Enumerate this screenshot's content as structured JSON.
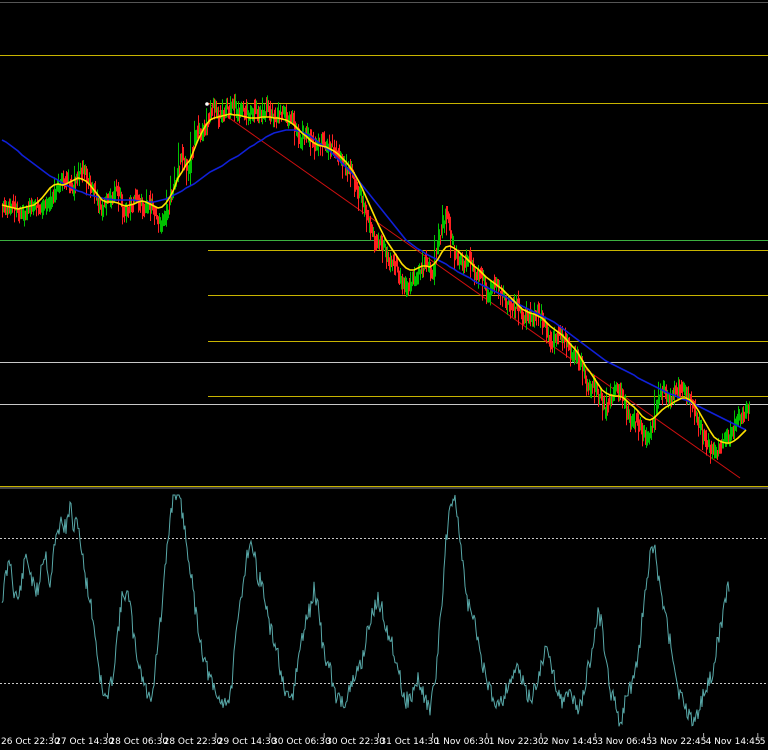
{
  "colors": {
    "background": "#000000",
    "bull_candle": "#00c000",
    "bear_candle": "#ff2020",
    "ma_fast": "#ffe000",
    "ma_slow": "#1020d8",
    "fib_level": "#c8b400",
    "horizontal_white": "#c8c8c8",
    "horizontal_green": "#3cb040",
    "trendline": "#d01010",
    "oscillator": "#58a8a8",
    "osc_level": "#c8c8c8",
    "text": "#ffffff"
  },
  "chart_data": [
    {
      "type": "candlestick",
      "panel": "price",
      "x": [
        0,
        4,
        8,
        12,
        16,
        20,
        24,
        28,
        32,
        36,
        40,
        44,
        48,
        52,
        56,
        60,
        64,
        68,
        72,
        76,
        80,
        84,
        88,
        92,
        96,
        100,
        104,
        108,
        112,
        116,
        120,
        124,
        128,
        132,
        136,
        140,
        144,
        148,
        152,
        156,
        160,
        164,
        168,
        172,
        176,
        180,
        184,
        188,
        192,
        196,
        200,
        204,
        208,
        212,
        216,
        220,
        224,
        228,
        232,
        236,
        240,
        244,
        248,
        252,
        256,
        260,
        264,
        268,
        272,
        276,
        280,
        284,
        288,
        292,
        296,
        300,
        304,
        308,
        312,
        316,
        320,
        324,
        328,
        332,
        336,
        340,
        344,
        348,
        352,
        356,
        360,
        364,
        368,
        372,
        376,
        380,
        384,
        388,
        392,
        396,
        400,
        404,
        408,
        412,
        416,
        420,
        424,
        428,
        432,
        436,
        440,
        444,
        448,
        452,
        456,
        460,
        464,
        468,
        472,
        476,
        480,
        484,
        488,
        492,
        496,
        500,
        504,
        508,
        512,
        516,
        520,
        524,
        528,
        532,
        536,
        540,
        544,
        548,
        552,
        556,
        560,
        564,
        568,
        572,
        576,
        580,
        584,
        588,
        592,
        596,
        600,
        604,
        608,
        612,
        616,
        620,
        624,
        628,
        632,
        636,
        640,
        644,
        648,
        652,
        656,
        660,
        664,
        668,
        672,
        676,
        680,
        684,
        688,
        692,
        696,
        700,
        704,
        708,
        712,
        716,
        720,
        724,
        728,
        732,
        736,
        740,
        744,
        748,
        752,
        756,
        760,
        764
      ],
      "close_series": [
        210,
        208,
        205,
        212,
        215,
        214,
        210,
        208,
        205,
        210,
        207,
        200,
        195,
        188,
        182,
        178,
        185,
        190,
        176,
        168,
        175,
        185,
        190,
        200,
        210,
        205,
        200,
        195,
        185,
        205,
        215,
        210,
        200,
        198,
        205,
        210,
        200,
        212,
        220,
        225,
        218,
        200,
        185,
        175,
        150,
        165,
        175,
        140,
        125,
        135,
        130,
        115,
        105,
        115,
        120,
        110,
        108,
        100,
        118,
        112,
        108,
        115,
        110,
        112,
        120,
        108,
        110,
        116,
        120,
        110,
        115,
        118,
        120,
        135,
        140,
        130,
        138,
        145,
        150,
        140,
        148,
        145,
        150,
        155,
        160,
        170,
        165,
        180,
        190,
        200,
        210,
        225,
        235,
        245,
        240,
        255,
        265,
        262,
        270,
        280,
        290,
        285,
        280,
        275,
        270,
        260,
        265,
        275,
        245,
        230,
        210,
        225,
        250,
        260,
        262,
        265,
        255,
        270,
        280,
        275,
        290,
        295,
        285,
        288,
        295,
        300,
        305,
        310,
        300,
        315,
        320,
        312,
        318,
        310,
        320,
        325,
        340,
        345,
        330,
        335,
        342,
        348,
        360,
        355,
        365,
        380,
        390,
        385,
        395,
        400,
        410,
        398,
        392,
        390,
        395,
        405,
        420,
        425,
        418,
        430,
        440,
        435,
        425,
        400,
        390,
        395,
        400,
        395,
        390,
        388,
        392,
        400,
        410,
        420,
        430,
        440,
        450,
        455,
        448,
        442,
        440,
        438,
        430,
        420,
        415,
        412,
        410
      ]
    },
    {
      "type": "line",
      "panel": "price",
      "series": [
        {
          "values": [
            205,
            206,
            207,
            208,
            209,
            208,
            207,
            206,
            205,
            202,
            198,
            193,
            188,
            185,
            184,
            185,
            184,
            182,
            180,
            178,
            179,
            181,
            185,
            190,
            195,
            200,
            202,
            202,
            202,
            203,
            205,
            206,
            205,
            204,
            202,
            201,
            202,
            204,
            206,
            208,
            207,
            203,
            197,
            189,
            178,
            172,
            165,
            160,
            150,
            140,
            132,
            125,
            120,
            118,
            117,
            116,
            115,
            114,
            115,
            115,
            116,
            117,
            118,
            118,
            118,
            117,
            117,
            117,
            118,
            118,
            119,
            120,
            122,
            125,
            129,
            133,
            136,
            140,
            143,
            145,
            146,
            147,
            149,
            151,
            154,
            158,
            162,
            167,
            173,
            180,
            188,
            197,
            206,
            215,
            224,
            232,
            240,
            246,
            252,
            258,
            264,
            268,
            270,
            270,
            268,
            266,
            266,
            267,
            264,
            259,
            252,
            247,
            246,
            248,
            251,
            255,
            258,
            262,
            266,
            269,
            273,
            277,
            280,
            283,
            286,
            289,
            293,
            297,
            301,
            305,
            309,
            311,
            313,
            314,
            316,
            318,
            322,
            326,
            329,
            332,
            335,
            339,
            344,
            348,
            353,
            360,
            367,
            372,
            378,
            384,
            390,
            393,
            395,
            396,
            396,
            397,
            400,
            404,
            407,
            411,
            416,
            419,
            420,
            418,
            414,
            410,
            407,
            405,
            402,
            400,
            398,
            398,
            400,
            404,
            410,
            417,
            424,
            431,
            437,
            440,
            442,
            443,
            443,
            441,
            438,
            434,
            430
          ]
        },
        {
          "values": [
            140,
            142,
            145,
            148,
            151,
            155,
            158,
            161,
            164,
            167,
            170,
            173,
            176,
            178,
            180,
            183,
            185,
            187,
            189,
            191,
            192,
            194,
            195,
            196,
            197,
            198,
            199,
            199,
            200,
            200,
            200,
            200,
            200,
            200,
            201,
            201,
            202,
            202,
            202,
            201,
            200,
            199,
            197,
            195,
            193,
            191,
            188,
            186,
            184,
            181,
            178,
            175,
            172,
            170,
            168,
            166,
            163,
            160,
            158,
            156,
            153,
            150,
            147,
            145,
            142,
            140,
            137,
            135,
            133,
            132,
            131,
            130,
            130,
            130,
            131,
            132,
            134,
            136,
            139,
            142,
            145,
            148,
            151,
            155,
            159,
            163,
            167,
            171,
            175,
            180,
            185,
            190,
            195,
            200,
            205,
            210,
            215,
            220,
            225,
            230,
            235,
            240,
            243,
            246,
            249,
            251,
            254,
            256,
            258,
            260,
            262,
            264,
            267,
            269,
            272,
            274,
            276,
            278,
            281,
            283,
            285,
            287,
            289,
            291,
            293,
            295,
            297,
            300,
            302,
            304,
            306,
            308,
            310,
            312,
            314,
            316,
            318,
            320,
            322,
            325,
            328,
            331,
            334,
            337,
            340,
            343,
            346,
            349,
            352,
            355,
            358,
            361,
            363,
            365,
            367,
            369,
            371,
            373,
            375,
            378,
            380,
            382,
            384,
            386,
            388,
            390,
            392,
            394,
            395,
            397,
            399,
            400,
            402,
            404,
            406,
            408,
            410,
            412,
            414,
            416,
            418,
            420,
            422,
            424,
            426,
            428,
            430
          ]
        }
      ]
    },
    {
      "type": "line",
      "panel": "oscillator",
      "series": [
        {
          "values": [
            600,
            575,
            560,
            590,
            600,
            580,
            555,
            570,
            590,
            590,
            560,
            555,
            585,
            550,
            530,
            520,
            530,
            505,
            530,
            520,
            555,
            580,
            600,
            625,
            660,
            690,
            700,
            690,
            665,
            630,
            600,
            590,
            605,
            640,
            660,
            675,
            690,
            700,
            680,
            640,
            610,
            560,
            520,
            490,
            495,
            510,
            540,
            565,
            600,
            625,
            650,
            665,
            680,
            690,
            700,
            700,
            700,
            700,
            660,
            620,
            590,
            560,
            540,
            555,
            575,
            585,
            605,
            630,
            640,
            655,
            680,
            700,
            700,
            690,
            660,
            640,
            620,
            610,
            590,
            605,
            640,
            660,
            670,
            690,
            700,
            700,
            700,
            690,
            680,
            670,
            660,
            640,
            620,
            610,
            600,
            610,
            625,
            640,
            650,
            665,
            690,
            700,
            700,
            690,
            680,
            690,
            700,
            710,
            690,
            650,
            600,
            540,
            505,
            495,
            520,
            560,
            595,
            610,
            620,
            640,
            660,
            680,
            690,
            700,
            700,
            700,
            690,
            680,
            670,
            670,
            680,
            690,
            700,
            690,
            680,
            660,
            650,
            660,
            675,
            690,
            700,
            700,
            690,
            700,
            710,
            700,
            680,
            660,
            640,
            610,
            625,
            660,
            690,
            700,
            720,
            715,
            700,
            690,
            680,
            660,
            620,
            590,
            560,
            540,
            575,
            600,
            620,
            640,
            660,
            690,
            700,
            710,
            715,
            720,
            710,
            700,
            690,
            680,
            665,
            640,
            620,
            600,
            580
          ]
        }
      ]
    }
  ],
  "levels": {
    "horizontal": [
      55,
      240,
      362,
      404,
      486
    ],
    "fib": [
      103,
      250,
      295,
      341,
      396
    ],
    "osc": [
      538,
      683
    ]
  },
  "time_labels": [
    "26 Oct 22:30",
    "27 Oct 14:30",
    "28 Oct 06:30",
    "28 Oct 22:30",
    "29 Oct 14:30",
    "30 Oct 06:30",
    "30 Oct 22:30",
    "31 Oct 14:30",
    "1 Nov 06:30",
    "1 Nov 22:30",
    "2 Nov 14:45",
    "3 Nov 06:45",
    "3 Nov 22:45",
    "4 Nov 14:45",
    "5"
  ]
}
